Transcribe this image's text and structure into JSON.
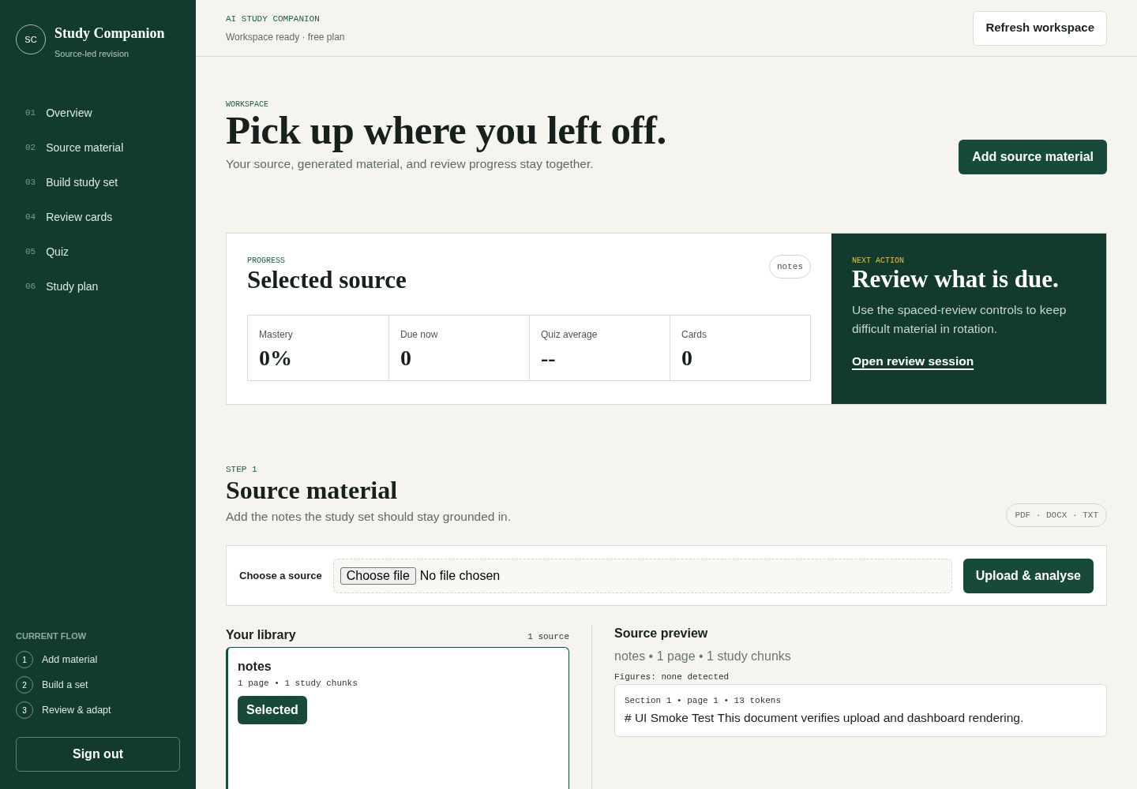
{
  "sidebar": {
    "brand": {
      "mark": "SC",
      "title": "Study Companion",
      "subtitle": "Source-led revision"
    },
    "nav": [
      {
        "number": "01",
        "label": "Overview",
        "selected": false
      },
      {
        "number": "02",
        "label": "Source material",
        "selected": false
      },
      {
        "number": "03",
        "label": "Build study set",
        "selected": false
      },
      {
        "number": "04",
        "label": "Review cards",
        "selected": false
      },
      {
        "number": "05",
        "label": "Quiz",
        "selected": false
      },
      {
        "number": "06",
        "label": "Study plan",
        "selected": false
      }
    ],
    "flow": {
      "heading": "CURRENT FLOW",
      "steps": [
        {
          "number": "1",
          "label": "Add material"
        },
        {
          "number": "2",
          "label": "Build a set"
        },
        {
          "number": "3",
          "label": "Review & adapt"
        }
      ]
    },
    "sign_out": "Sign out"
  },
  "header": {
    "eyebrow": "AI STUDY COMPANION",
    "status": "Workspace ready · free plan",
    "button": "Refresh workspace"
  },
  "hero": {
    "eyebrow": "WORKSPACE",
    "title": "Pick up where you left off.",
    "subtitle": "Your source, generated material, and review progress stay together.",
    "button": "Add source material"
  },
  "progress": {
    "eyebrow": "PROGRESS",
    "title": "Selected source",
    "tag": "notes",
    "stats": [
      {
        "label": "Mastery",
        "value": "0%"
      },
      {
        "label": "Due now",
        "value": "0"
      },
      {
        "label": "Quiz average",
        "value": "--"
      },
      {
        "label": "Cards",
        "value": "0"
      }
    ]
  },
  "next_action": {
    "eyebrow": "NEXT ACTION",
    "title": "Review what is due.",
    "text": "Use the spaced-review controls to keep difficult material in rotation.",
    "link": "Open review session"
  },
  "source_step": {
    "eyebrow": "STEP 1",
    "title": "Source material",
    "subtitle": "Add the notes the study set should stay grounded in.",
    "formats": "PDF · DOCX · TXT",
    "upload": {
      "label": "Choose a source",
      "file_button": "Choose file",
      "file_status": "No file chosen",
      "button": "Upload & analyse"
    }
  },
  "library": {
    "title": "Your library",
    "count": "1 source",
    "items": [
      {
        "name": "notes",
        "meta": "1 page • 1 study chunks",
        "selected": true,
        "action": "Selected"
      }
    ]
  },
  "preview": {
    "title": "Source preview",
    "meta": "notes • 1 page • 1 study chunks",
    "figures": "Figures: none detected",
    "chunks": [
      {
        "heading": "Section 1 • page 1 • 13 tokens",
        "text": "# UI Smoke Test This document verifies upload and dashboard rendering."
      }
    ]
  }
}
